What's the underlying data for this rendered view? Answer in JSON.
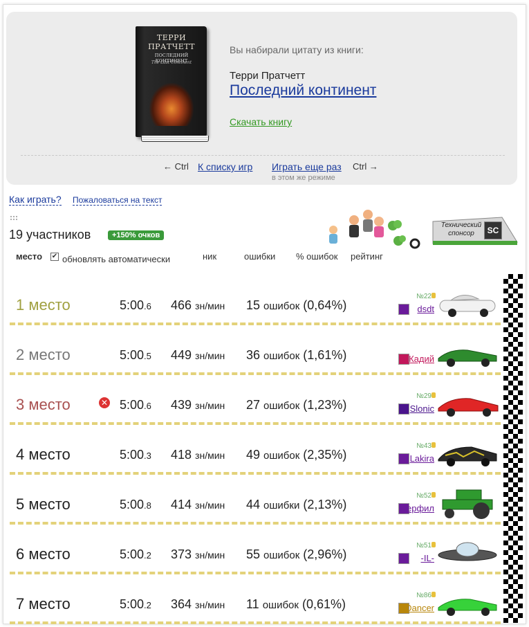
{
  "book": {
    "cover_author": "ТЕРРИ ПРАТЧЕТТ",
    "cover_title": "ПОСЛЕДНИЙ КОНТИНЕНТ",
    "cover_subtitle": "The Last Continent",
    "label": "Вы набирали цитату из книги:",
    "author": "Терри Пратчетт",
    "title": "Последний континент",
    "download": "Скачать книгу"
  },
  "nav": {
    "left_hint": "← Ctrl",
    "back": "К списку игр",
    "again": "Играть еще раз",
    "right_hint": "Ctrl →",
    "mode": "в этом же режиме"
  },
  "links": {
    "how": "Как играть?",
    "complain": "Пожаловаться на текст"
  },
  "participants": {
    "count": "19 участников",
    "bonus": "+150% очков"
  },
  "sponsor": {
    "text": "Технический спонсор",
    "logo": "SC"
  },
  "table_header": {
    "place": "место",
    "auto": "обновлять автоматически",
    "nick": "ник",
    "errors": "ошибки",
    "percent": "% ошибок",
    "rating": "рейтинг"
  },
  "rows": [
    {
      "place": "1 место",
      "time": "5:00",
      "frac": ".6",
      "speed": "466",
      "unit": "зн/мин",
      "errors": "15",
      "errword": "ошибок",
      "pct": "(0,64%)",
      "rank": "№22",
      "nick": "dsdt",
      "color": "#a0a040",
      "nick_color": "#6a1b9a",
      "car": "white"
    },
    {
      "place": "2 место",
      "time": "5:00",
      "frac": ".5",
      "speed": "449",
      "unit": "зн/мин",
      "errors": "36",
      "errword": "ошибок",
      "pct": "(1,61%)",
      "rank": "",
      "nick": "Кадий",
      "color": "#777777",
      "nick_color": "#c2185b",
      "car": "green"
    },
    {
      "place": "3 место",
      "time": "5:00",
      "frac": ".6",
      "speed": "439",
      "unit": "зн/мин",
      "errors": "27",
      "errword": "ошибок",
      "pct": "(1,23%)",
      "rank": "№29",
      "nick": "Slonic",
      "color": "#a85050",
      "nick_color": "#4a148c",
      "car": "red"
    },
    {
      "place": "4 место",
      "time": "5:00",
      "frac": ".3",
      "speed": "418",
      "unit": "зн/мин",
      "errors": "49",
      "errword": "ошибок",
      "pct": "(2,35%)",
      "rank": "№43",
      "nick": "Lakira",
      "color": "#222222",
      "nick_color": "#6a1b9a",
      "car": "camo"
    },
    {
      "place": "5 место",
      "time": "5:00",
      "frac": ".8",
      "speed": "414",
      "unit": "зн/мин",
      "errors": "44",
      "errword": "ошибки",
      "pct": "(2,13%)",
      "rank": "№52",
      "nick": "Перфил",
      "color": "#222222",
      "nick_color": "#6a1b9a",
      "car": "tractor"
    },
    {
      "place": "6 место",
      "time": "5:00",
      "frac": ".2",
      "speed": "373",
      "unit": "зн/мин",
      "errors": "55",
      "errword": "ошибок",
      "pct": "(2,96%)",
      "rank": "№51",
      "nick": "-IL-",
      "color": "#222222",
      "nick_color": "#6a1b9a",
      "car": "ufo"
    },
    {
      "place": "7 место",
      "time": "5:00",
      "frac": ".2",
      "speed": "364",
      "unit": "зн/мин",
      "errors": "11",
      "errword": "ошибок",
      "pct": "(0,61%)",
      "rank": "№86",
      "nick": "NDancer",
      "color": "#222222",
      "nick_color": "#b8860b",
      "car": "lime"
    }
  ]
}
